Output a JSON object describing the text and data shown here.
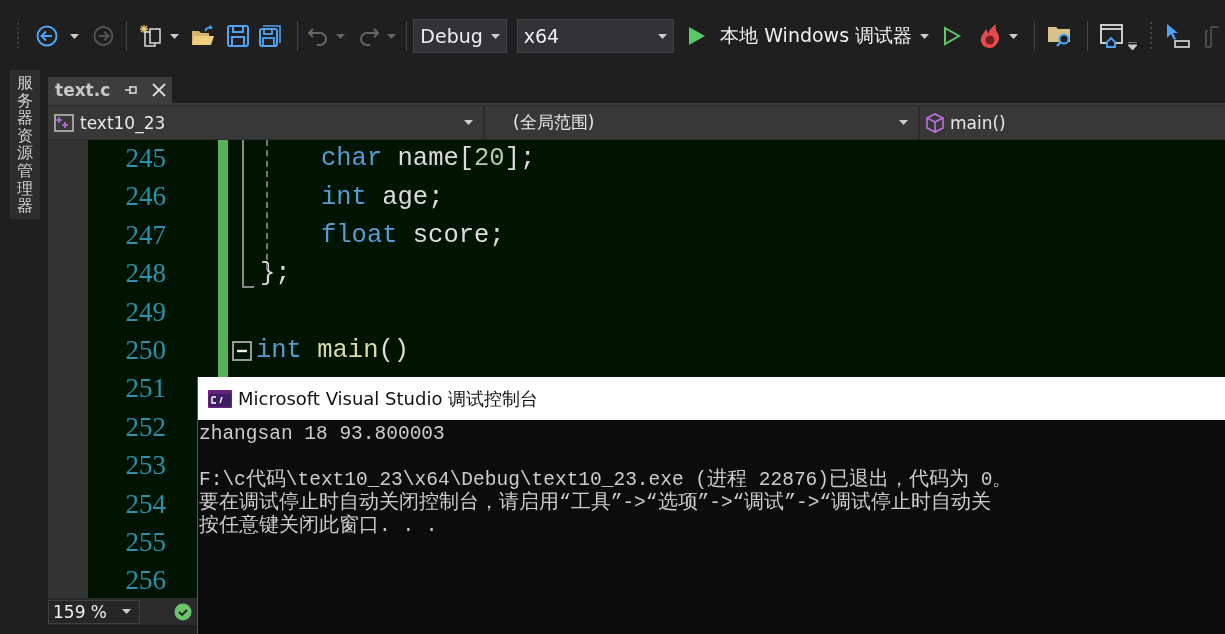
{
  "toolbar": {
    "configuration": "Debug",
    "platform": "x64",
    "debugger": "本地 Windows 调试器"
  },
  "side_tab": {
    "label": "服务器资源管理器"
  },
  "document_tabs": [
    {
      "label": "text.c",
      "selected": true
    }
  ],
  "nav_bar": {
    "project": "text10_23",
    "scope": "(全局范围)",
    "member": "main()"
  },
  "editor": {
    "zoom": "159 %",
    "lines": [
      {
        "number": "245",
        "indented": true,
        "foldable": false,
        "tokens": [
          {
            "kind": "keyword",
            "text": "char"
          },
          {
            "kind": "plain",
            "text": " name["
          },
          {
            "kind": "number",
            "text": "20"
          },
          {
            "kind": "plain",
            "text": "];"
          }
        ]
      },
      {
        "number": "246",
        "indented": true,
        "foldable": false,
        "tokens": [
          {
            "kind": "keyword",
            "text": "int"
          },
          {
            "kind": "plain",
            "text": " age;"
          }
        ]
      },
      {
        "number": "247",
        "indented": true,
        "foldable": false,
        "tokens": [
          {
            "kind": "keyword",
            "text": "float"
          },
          {
            "kind": "plain",
            "text": " score;"
          }
        ]
      },
      {
        "number": "248",
        "indented": false,
        "foldable": false,
        "tokens": [
          {
            "kind": "plain",
            "text": "};"
          }
        ]
      },
      {
        "number": "249"
      },
      {
        "number": "250",
        "indented": false,
        "foldable": true,
        "tokens": [
          {
            "kind": "keyword",
            "text": "int"
          },
          {
            "kind": "function",
            "text": " main"
          },
          {
            "kind": "plain",
            "text": "()"
          }
        ]
      },
      {
        "number": "251"
      },
      {
        "number": "252"
      },
      {
        "number": "253"
      },
      {
        "number": "254"
      },
      {
        "number": "255"
      },
      {
        "number": "256"
      }
    ]
  },
  "console": {
    "title": "Microsoft Visual Studio 调试控制台",
    "lines": [
      {
        "text": "zhangsan 18 93.800003",
        "gap_before": false
      },
      {
        "text": "F:\\c代码\\text10_23\\x64\\Debug\\text10_23.exe (进程 22876)已退出，代码为 0。",
        "gap_before": true
      },
      {
        "text": "要在调试停止时自动关闭控制台，请启用“工具”->“选项”->“调试”->“调试停止时自动关",
        "gap_before": false
      },
      {
        "text": "按任意键关闭此窗口. . .",
        "gap_before": false
      }
    ]
  }
}
